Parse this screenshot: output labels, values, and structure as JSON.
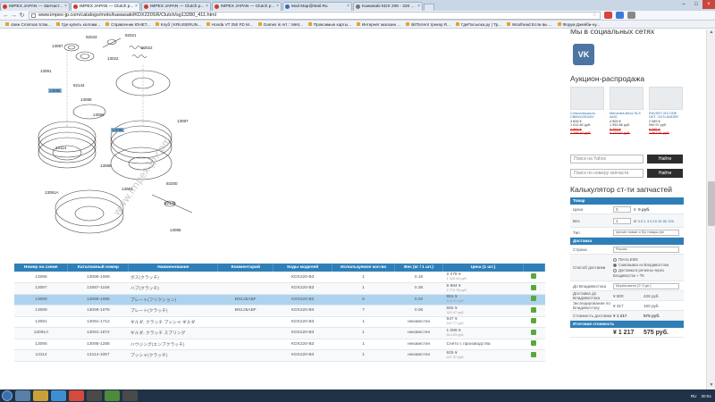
{
  "browser": {
    "tabs": [
      {
        "title": "IMPEX JAPAN — Запчаст...",
        "icon": "impex-favicon"
      },
      {
        "title": "IMPEX JAPAN — Clutch p...",
        "icon": "impex-favicon",
        "active": true
      },
      {
        "title": "IMPEX JAPAN — Clutch p...",
        "icon": "impex-favicon"
      },
      {
        "title": "IMPEX JAPAN — Clutch p...",
        "icon": "impex-favicon"
      },
      {
        "title": "Mail Map@Mail.Ru",
        "icon": "mail-favicon"
      },
      {
        "title": "Kawasaki KDX 200 - 220 ...",
        "icon": "page-favicon"
      }
    ],
    "url": "www.impex-jp.com/catalogs/moto/kawasaki/KDX220SR/Clutch/sg13280_411.html",
    "bookmarks": [
      "свеж Crosman 5.5м...",
      "Где купить коллим...",
      "Справочник ЮНЕТ...",
      "Клуб | KRUISERUN...",
      "Honda VT 250 FD M...",
      "Games is Art :: Metr...",
      "Проксимые карты...",
      "Интернет магазин ...",
      "BitTorrent трекер R...",
      "ГдеПосылка.ру | Тр...",
      "Woolhead Если вы ...",
      "Форум Джейби-ну..."
    ]
  },
  "diagram": {
    "callouts": [
      "92033",
      "13087",
      "92022",
      "13086",
      "13088",
      "92144",
      "13089",
      "13091",
      "13095",
      "13114",
      "92021",
      "13022",
      "13091A",
      "13087",
      "92200",
      "13088",
      "92145",
      "13081",
      "13095"
    ],
    "watermark": "www.impex-jp.com"
  },
  "parts_table": {
    "headers": [
      "Номер на схеме",
      "Каталожный номер",
      "Наименование",
      "Комментарий",
      "Коды моделей",
      "Используемое кол-во",
      "Вес (кг / 1 шт.)",
      "Цена (1 шт.)",
      ""
    ],
    "rows": [
      {
        "num": "13086",
        "catalog": "13086-1069",
        "name": "ボス(クラッチ)",
        "comment": "",
        "model": "KDX220-B3",
        "qty": "1",
        "weight": "0.16",
        "price": "2 278 ¥",
        "price_sub": "1 326.45 руб."
      },
      {
        "num": "13087",
        "catalog": "13087-1158",
        "name": "ハブ(クラッチ)",
        "comment": "",
        "model": "KDX220-B3",
        "qty": "1",
        "weight": "0.36",
        "price": "5 984 ¥",
        "price_sub": "2 772.76 руб."
      },
      {
        "num": "13088",
        "catalog": "13088-1085",
        "name": "プレート(フリクション)",
        "comment": "BN125ABF",
        "model": "KDX220-B3",
        "qty": "6",
        "weight": "0.02",
        "price": "881 ¥",
        "price_sub": "416.37 руб."
      },
      {
        "num": "13089",
        "catalog": "13089-1076",
        "name": "プレート(クラッチ)",
        "comment": "BN125ABF",
        "model": "KDX220-B3",
        "qty": "7",
        "weight": "0.06",
        "price": "682 ¥",
        "price_sub": "322.47 руб."
      },
      {
        "num": "13091",
        "catalog": "13091-1712",
        "name": "ギルダ, クラッチ プッシャ ギルダ",
        "comment": "",
        "model": "KDX220-B3",
        "qty": "1",
        "weight": "неизвестен",
        "price": "947 ¥",
        "price_sub": "447.77 руб."
      },
      {
        "num": "13091A",
        "catalog": "13091-1872",
        "name": "ギルダ, クラッチ スプリング",
        "comment": "",
        "model": "KDX220-B3",
        "qty": "1",
        "weight": "неизвестен",
        "price": "1 089 ¥",
        "price_sub": "514.93 руб."
      },
      {
        "num": "13095",
        "catalog": "13095-1288",
        "name": "ハウジング(エンブクラッチ)",
        "comment": "",
        "model": "KDX220-B3",
        "qty": "1",
        "weight": "неизвестен",
        "price": "Снято с производства",
        "price_sub": ""
      },
      {
        "num": "13114",
        "catalog": "13114-1067",
        "name": "プッシャ(クラッチ)",
        "comment": "",
        "model": "KDX220-B3",
        "qty": "1",
        "weight": "неизвестен",
        "price": "925 ¥",
        "price_sub": "437.37 руб."
      }
    ],
    "selected_row": 2
  },
  "sidebar": {
    "social_heading": "Мы в социальных сетях",
    "vk_label": "VK",
    "auction_heading": "Аукцион-распродажа",
    "lots": [
      {
        "title": "Стекло/зеркало CB600/CB1000",
        "price1": "3 606 ¥",
        "price2": "1 612.82 руб.",
        "old1": "4 865 ¥",
        "old2": "2 296.40 руб."
      },
      {
        "title": "Mercedes-Benz SLS AMG",
        "price1": "4 509 ¥",
        "price2": "1 992.86 руб.",
        "old1": "6 753 ¥",
        "old2": "3 172.67 руб."
      },
      {
        "title": "ENVIRO VDI ONE GET. OUTLANDER",
        "price1": "2 089 ¥",
        "price2": "990.97 руб.",
        "old1": "6 085 ¥",
        "old2": "2 867.91 руб."
      }
    ],
    "search_yahoo_placeholder": "Поиск на Yahoo",
    "search_part_placeholder": "Поиск по номеру запчасти",
    "search_button": "Найти",
    "calc_heading": "Калькулятор ст-ти запчастей",
    "calc": {
      "section_goods": "Товар",
      "price_label": "Цена",
      "price_value": "0",
      "price_rub": "0 руб.",
      "weight_label": "Вес",
      "weight_value": "1",
      "weight_unit": "кг",
      "weight_options": "0.5  1  3  5  10  30  50  100",
      "type_label": "Тип",
      "type_value": "прочие новые и б/у товары (не",
      "section_delivery": "Доставка",
      "country_label": "Страна",
      "country_value": "Россия",
      "method_label": "Способ доставки",
      "method_options": [
        "Почта EMS",
        "Самовывоз из Владивостока",
        "Доставка в регионы через Владивосток + ТК"
      ],
      "to_vlad_label": "До Владивостока",
      "to_vlad_value": "Морем-вагон (2~3 дн.)",
      "deliv_label": "Доставка до Владивостока",
      "deliv_yen": "¥ 900",
      "deliv_rub": "426 руб.",
      "exp_label": "Экспедирование по Владивостоку",
      "exp_yen": "¥ 317",
      "exp_rub": "150 руб.",
      "cost_label": "Стоимость доставки",
      "cost_yen": "¥ 1 217",
      "cost_rub": "575 руб.",
      "section_total": "Итоговая стоимость",
      "total_yen": "¥ 1 217",
      "total_rub": "575 руб."
    }
  },
  "taskbar": {
    "lang": "RU",
    "time": "20:51"
  }
}
